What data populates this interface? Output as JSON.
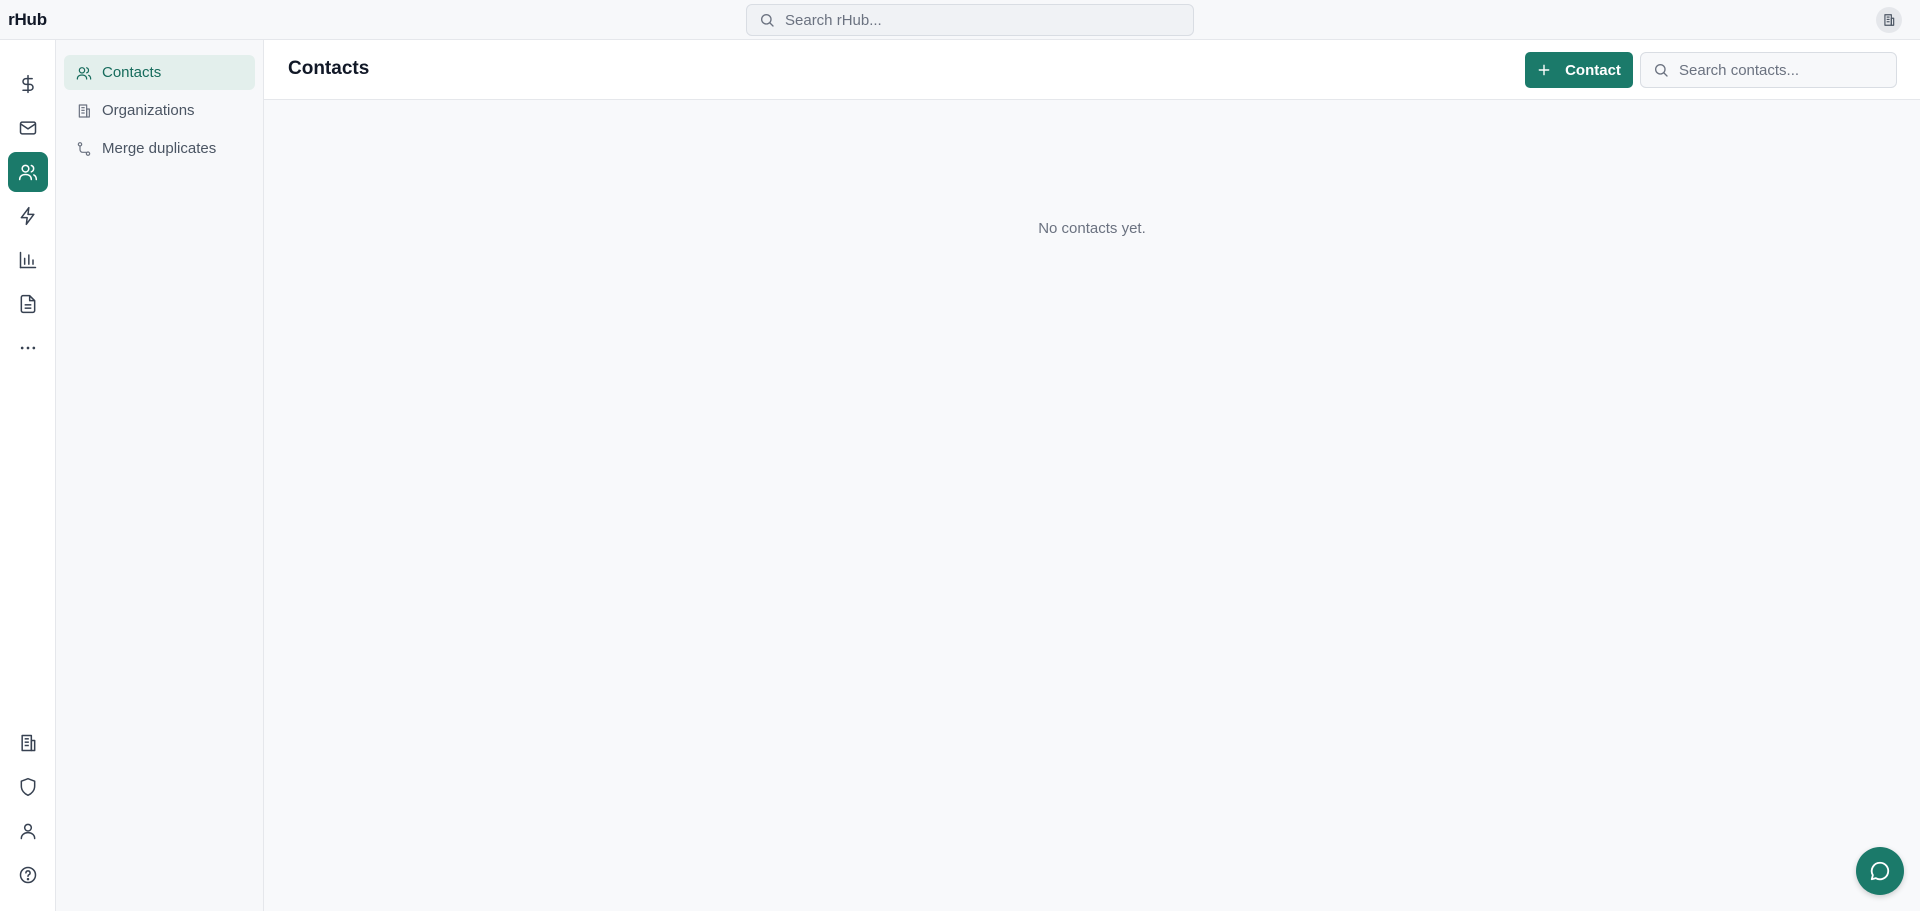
{
  "app": {
    "brand": "rHub"
  },
  "topbar": {
    "search_placeholder": "Search rHub..."
  },
  "rail": {
    "top_icons": [
      "dollar-icon",
      "mail-icon",
      "users-icon",
      "lightning-icon",
      "bar-chart-icon",
      "document-icon",
      "more-icon"
    ],
    "bottom_icons": [
      "building-icon",
      "shield-icon",
      "user-icon",
      "help-icon"
    ],
    "active": "users-icon"
  },
  "subnav": {
    "items": [
      {
        "label": "Contacts",
        "icon": "users-icon",
        "active": true
      },
      {
        "label": "Organizations",
        "icon": "building-icon",
        "active": false
      },
      {
        "label": "Merge duplicates",
        "icon": "merge-icon",
        "active": false
      }
    ]
  },
  "main": {
    "title": "Contacts",
    "add_button_label": "Contact",
    "search_placeholder": "Search contacts...",
    "empty_message": "No contacts yet."
  },
  "colors": {
    "accent": "#1b7a6a",
    "active_nav_bg": "#e3efec",
    "active_nav_text": "#166b5c"
  }
}
